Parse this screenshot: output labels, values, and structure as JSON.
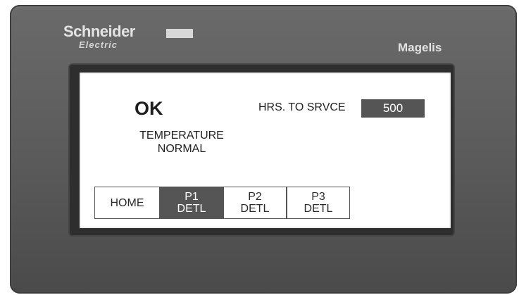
{
  "device": {
    "brand": "Schneider",
    "brand_sub": "Electric",
    "model": "Magelis"
  },
  "status": {
    "state": "OK",
    "message": "TEMPERATURE\nNORMAL"
  },
  "service": {
    "label": "HRS. TO SRVCE",
    "hours": "500"
  },
  "nav": {
    "buttons": [
      {
        "label": "HOME",
        "active": false
      },
      {
        "label": "P1\nDETL",
        "active": true
      },
      {
        "label": "P2\nDETL",
        "active": false
      },
      {
        "label": "P3\nDETL",
        "active": false
      }
    ]
  },
  "colors": {
    "bezel": "#5f5f5f",
    "active_button": "#555555",
    "value_box": "#555555",
    "screen_bg": "#ffffff"
  }
}
